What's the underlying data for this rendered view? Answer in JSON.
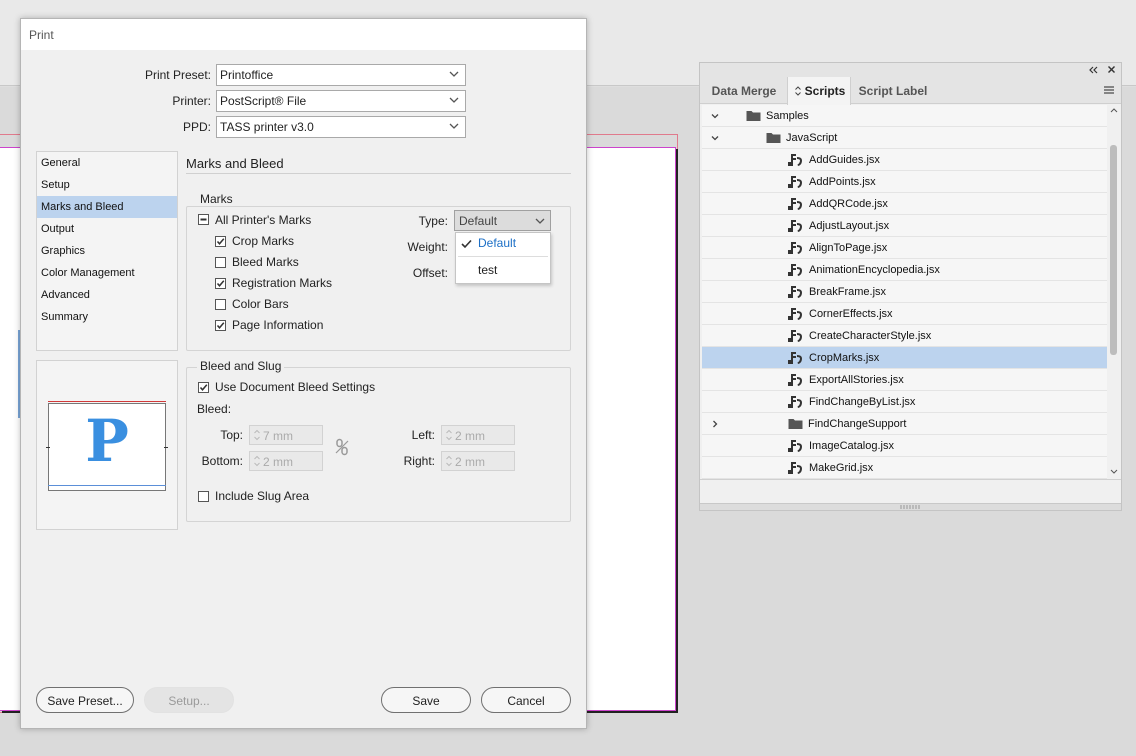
{
  "dialog": {
    "title": "Print",
    "preset_label": "Print Preset:",
    "preset_value": "Printoffice",
    "printer_label": "Printer:",
    "printer_value": "PostScript® File",
    "ppd_label": "PPD:",
    "ppd_value": "TASS printer v3.0",
    "categories": [
      "General",
      "Setup",
      "Marks and Bleed",
      "Output",
      "Graphics",
      "Color Management",
      "Advanced",
      "Summary"
    ],
    "selected_category": "Marks and Bleed",
    "section_title": "Marks and Bleed",
    "marks": {
      "legend": "Marks",
      "all_printers_marks": "All Printer's Marks",
      "crop_marks": "Crop Marks",
      "bleed_marks": "Bleed Marks",
      "registration_marks": "Registration Marks",
      "color_bars": "Color Bars",
      "page_information": "Page Information",
      "type_label": "Type:",
      "type_value": "Default",
      "weight_label": "Weight:",
      "offset_label": "Offset:",
      "type_options": [
        "Default",
        "test"
      ]
    },
    "bleed": {
      "legend": "Bleed and Slug",
      "use_doc_bleed": "Use Document Bleed Settings",
      "bleed_label": "Bleed:",
      "top_label": "Top:",
      "top_value": "7 mm",
      "bottom_label": "Bottom:",
      "bottom_value": "2 mm",
      "left_label": "Left:",
      "left_value": "2 mm",
      "right_label": "Right:",
      "right_value": "2 mm",
      "include_slug": "Include Slug Area"
    },
    "preview_glyph": "P",
    "buttons": {
      "save_preset": "Save Preset...",
      "setup": "Setup...",
      "save": "Save",
      "cancel": "Cancel"
    }
  },
  "panel": {
    "tabs": [
      "Data Merge",
      "Scripts",
      "Script Label"
    ],
    "active_tab": "Scripts",
    "tree": [
      {
        "label": "Samples",
        "type": "folder",
        "level": 0,
        "expanded": true
      },
      {
        "label": "JavaScript",
        "type": "folder",
        "level": 1,
        "expanded": true
      },
      {
        "label": "AddGuides.jsx",
        "type": "script",
        "level": 2
      },
      {
        "label": "AddPoints.jsx",
        "type": "script",
        "level": 2
      },
      {
        "label": "AddQRCode.jsx",
        "type": "script",
        "level": 2
      },
      {
        "label": "AdjustLayout.jsx",
        "type": "script",
        "level": 2
      },
      {
        "label": "AlignToPage.jsx",
        "type": "script",
        "level": 2
      },
      {
        "label": "AnimationEncyclopedia.jsx",
        "type": "script",
        "level": 2
      },
      {
        "label": "BreakFrame.jsx",
        "type": "script",
        "level": 2
      },
      {
        "label": "CornerEffects.jsx",
        "type": "script",
        "level": 2
      },
      {
        "label": "CreateCharacterStyle.jsx",
        "type": "script",
        "level": 2
      },
      {
        "label": "CropMarks.jsx",
        "type": "script",
        "level": 2,
        "selected": true
      },
      {
        "label": "ExportAllStories.jsx",
        "type": "script",
        "level": 2
      },
      {
        "label": "FindChangeByList.jsx",
        "type": "script",
        "level": 2
      },
      {
        "label": "FindChangeSupport",
        "type": "folder",
        "level": 2,
        "expanded": false
      },
      {
        "label": "ImageCatalog.jsx",
        "type": "script",
        "level": 2
      },
      {
        "label": "MakeGrid.jsx",
        "type": "script",
        "level": 2
      }
    ]
  }
}
